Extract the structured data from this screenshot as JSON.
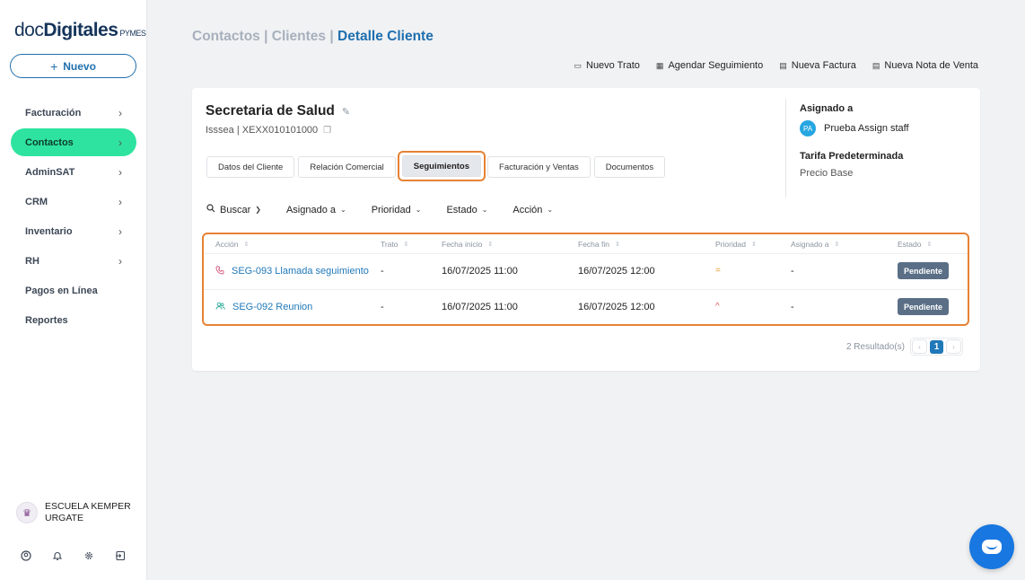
{
  "brand": {
    "part1": "doc",
    "part2": "Digitales",
    "suffix": "PYMES"
  },
  "sidebar": {
    "new_button": "Nuevo",
    "items": [
      {
        "label": "Facturación",
        "chevron": "›"
      },
      {
        "label": "Contactos",
        "chevron": "›"
      },
      {
        "label": "AdminSAT",
        "chevron": "›"
      },
      {
        "label": "CRM",
        "chevron": "›"
      },
      {
        "label": "Inventario",
        "chevron": "›"
      },
      {
        "label": "RH",
        "chevron": "›"
      },
      {
        "label": "Pagos en Línea"
      },
      {
        "label": "Reportes"
      }
    ],
    "user": {
      "name": "ESCUELA KEMPER URGATE"
    }
  },
  "breadcrumb": {
    "part1": "Contactos",
    "sep": " | ",
    "part2": "Clientes",
    "current": "Detalle Cliente"
  },
  "actions": {
    "nuevo_trato": "Nuevo Trato",
    "agendar": "Agendar Seguimiento",
    "nueva_factura": "Nueva Factura",
    "nueva_nota": "Nueva Nota de Venta"
  },
  "client": {
    "name": "Secretaria de Salud",
    "sub": "Isssea | XEXX010101000"
  },
  "tabs": {
    "datos": "Datos del Cliente",
    "relacion": "Relación Comercial",
    "seguimientos": "Seguimientos",
    "facturacion": "Facturación y Ventas",
    "documentos": "Documentos"
  },
  "side_info": {
    "assigned_label": "Asignado a",
    "assignee_initials": "PA",
    "assignee_name": "Prueba Assign staff",
    "tarifa_label": "Tarifa Predeterminada",
    "tarifa_value": "Precio Base"
  },
  "filters": {
    "buscar": "Buscar",
    "asignado": "Asignado a",
    "prioridad": "Prioridad",
    "estado": "Estado",
    "accion": "Acción"
  },
  "table": {
    "headers": {
      "accion": "Acción",
      "trato": "Trato",
      "fecha_inicio": "Fecha inicio",
      "fecha_fin": "Fecha fin",
      "prioridad": "Prioridad",
      "asignado": "Asignado a",
      "estado": "Estado"
    },
    "rows": [
      {
        "accion": "SEG-093 Llamada seguimiento",
        "icon": "phone-icon",
        "trato": "-",
        "fecha_inicio": "16/07/2025 11:00",
        "fecha_fin": "16/07/2025 12:00",
        "prioridad": "=",
        "prioridad_color": "#e8962e",
        "asignado": "-",
        "estado": "Pendiente"
      },
      {
        "accion": "SEG-092 Reunion",
        "icon": "people-icon",
        "trato": "-",
        "fecha_inicio": "16/07/2025 11:00",
        "fecha_fin": "16/07/2025 12:00",
        "prioridad": "^",
        "prioridad_color": "#e05a5a",
        "asignado": "-",
        "estado": "Pendiente"
      }
    ]
  },
  "pagination": {
    "results": "2 Resultado(s)",
    "page": "1"
  },
  "colors": {
    "accent": "#1f6fae",
    "active_nav": "#2ee39f",
    "highlight": "#e68234",
    "badge": "#5a6f86"
  }
}
